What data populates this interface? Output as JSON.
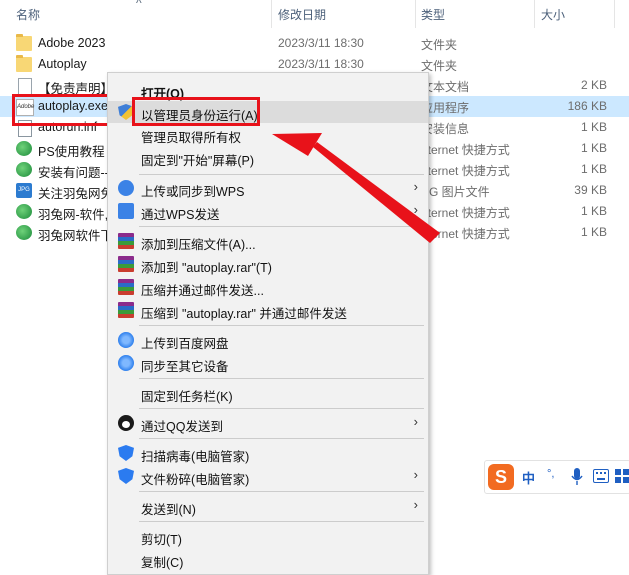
{
  "header": {
    "name": "名称",
    "date": "修改日期",
    "type": "类型",
    "size": "大小"
  },
  "files": [
    {
      "name": "Adobe 2023",
      "date": "2023/3/11 18:30",
      "type": "文件夹",
      "size": "",
      "icon": "folder-icon"
    },
    {
      "name": "Autoplay",
      "date": "2023/3/11 18:30",
      "type": "文件夹",
      "size": "",
      "icon": "folder-icon"
    },
    {
      "name": "【免责声明】",
      "date": "",
      "type": "文本文档",
      "size": "2 KB",
      "icon": "text-file-icon"
    },
    {
      "name": "autoplay.exe",
      "date": "",
      "type": "应用程序",
      "size": "186 KB",
      "icon": "adobe-exe-icon"
    },
    {
      "name": "autorun.inf",
      "date": "",
      "type": "安装信息",
      "size": "1 KB",
      "icon": "setup-info-icon"
    },
    {
      "name": "PS使用教程",
      "date": "",
      "type": "nternet 快捷方式",
      "size": "1 KB",
      "icon": "internet-shortcut-icon"
    },
    {
      "name": "安装有问题--",
      "date": "",
      "type": "nternet 快捷方式",
      "size": "1 KB",
      "icon": "internet-shortcut-icon"
    },
    {
      "name": "关注羽兔网免",
      "date": "",
      "type": "PG 图片文件",
      "size": "39 KB",
      "icon": "image-file-icon"
    },
    {
      "name": "羽兔网-软件,",
      "date": "",
      "type": "nternet 快捷方式",
      "size": "1 KB",
      "icon": "internet-shortcut-icon"
    },
    {
      "name": "羽兔网软件下",
      "date": "",
      "type": "nternet 快捷方式",
      "size": "1 KB",
      "icon": "internet-shortcut-icon"
    }
  ],
  "menu": {
    "open": "打开(O)",
    "run_as_admin": "以管理员身份运行(A)",
    "take_ownership": "管理员取得所有权",
    "pin_start": "固定到\"开始\"屏幕(P)",
    "upload_wps": "上传或同步到WPS",
    "send_wps": "通过WPS发送",
    "add_archive": "添加到压缩文件(A)...",
    "add_rar": "添加到 \"autoplay.rar\"(T)",
    "compress_email": "压缩并通过邮件发送...",
    "compress_rar_email": "压缩到 \"autoplay.rar\" 并通过邮件发送",
    "upload_baidu": "上传到百度网盘",
    "sync_devices": "同步至其它设备",
    "pin_taskbar": "固定到任务栏(K)",
    "send_qq": "通过QQ发送到",
    "scan_virus": "扫描病毒(电脑管家)",
    "shred_file": "文件粉碎(电脑管家)",
    "send_to": "发送到(N)",
    "cut": "剪切(T)",
    "copy": "复制(C)"
  },
  "ime": {
    "logo": "S",
    "lang": "中",
    "punct": "°,"
  },
  "colors": {
    "highlight_red": "#e8121a",
    "selection_blue": "#cce8ff",
    "menu_bg": "#f2f2f2"
  }
}
